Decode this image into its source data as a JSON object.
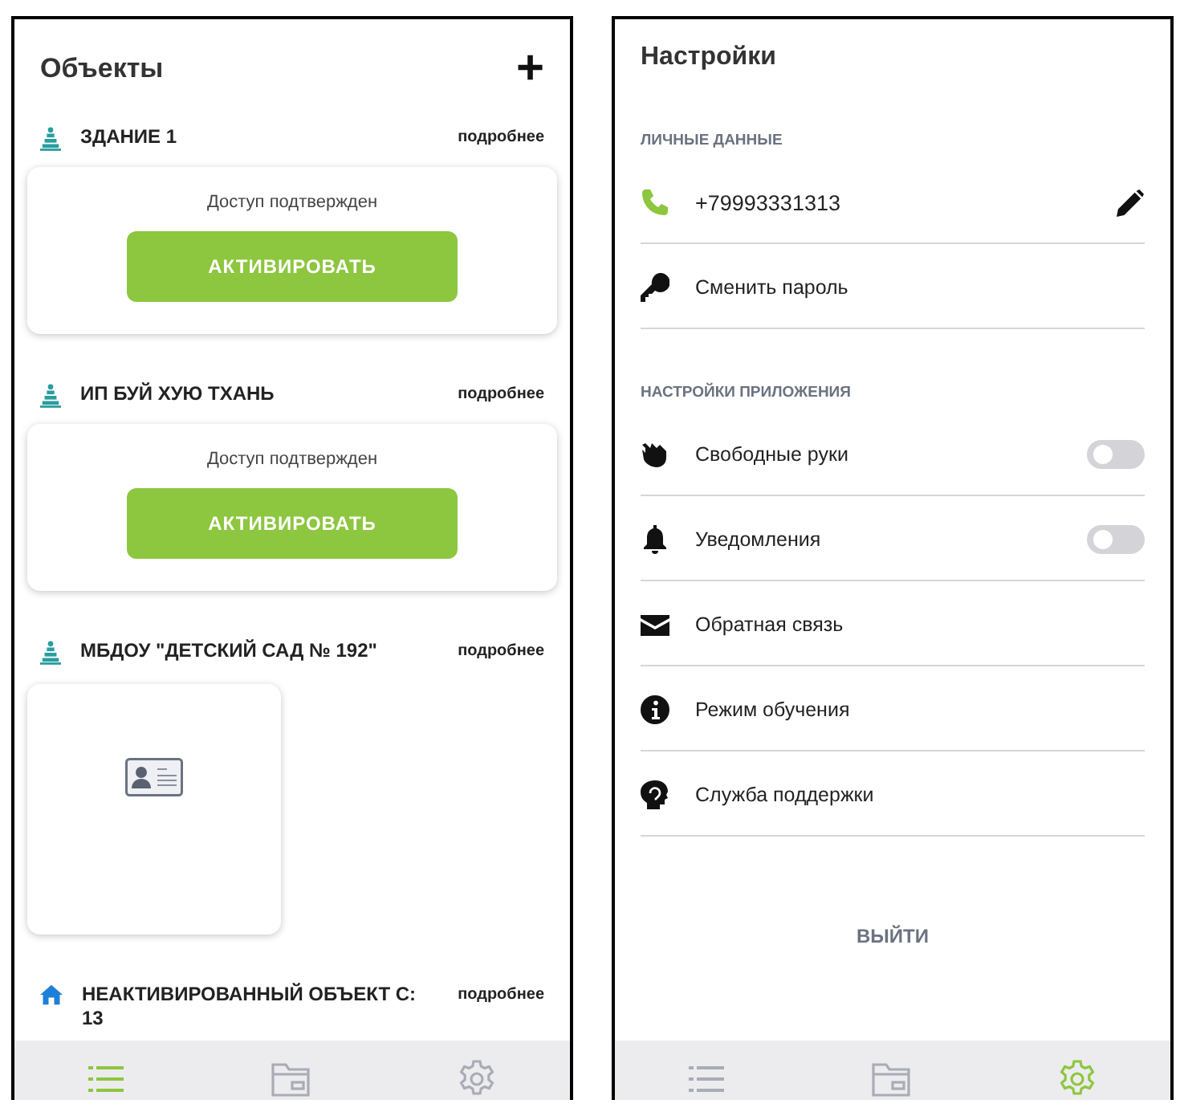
{
  "objects_screen": {
    "title": "Объекты",
    "add_button": "+",
    "objects": [
      {
        "kind": "active",
        "name": "ЗДАНИЕ 1",
        "link": "подробнее",
        "card": {
          "kind": "access",
          "status": "Доступ подтвержден",
          "button": "АКТИВИРОВАТЬ"
        }
      },
      {
        "kind": "active",
        "name": "ИП БУЙ ХУЮ ТХАНЬ",
        "link": "подробнее",
        "card": {
          "kind": "access",
          "status": "Доступ подтвержден",
          "button": "АКТИВИРОВАТЬ"
        }
      },
      {
        "kind": "active",
        "name": "МБДОУ \"ДЕТСКИЙ САД № 192\"",
        "link": "подробнее",
        "card": {
          "kind": "id_card"
        }
      },
      {
        "kind": "inactive",
        "name": "НЕАКТИВИРОВАННЫЙ ОБЪЕКТ С: 13",
        "link": "подробнее"
      }
    ],
    "nav": [
      {
        "selected": true
      },
      {
        "selected": false
      },
      {
        "selected": false
      }
    ]
  },
  "settings_screen": {
    "title": "Настройки",
    "sections": [
      {
        "title": "ЛИЧНЫЕ ДАННЫЕ",
        "items": [
          {
            "label": "+79993331313",
            "kind": "edit"
          },
          {
            "label": "Сменить пароль",
            "kind": "plain"
          }
        ]
      },
      {
        "title": "НАСТРОЙКИ ПРИЛОЖЕНИЯ",
        "items": [
          {
            "label": "Свободные руки",
            "kind": "toggle",
            "on": false
          },
          {
            "label": "Уведомления",
            "kind": "toggle",
            "on": false
          },
          {
            "label": "Обратная связь",
            "kind": "plain"
          },
          {
            "label": "Режим обучения",
            "kind": "plain"
          },
          {
            "label": "Служба поддержки",
            "kind": "plain"
          }
        ]
      }
    ],
    "logout": "ВЫЙТИ",
    "nav": [
      {
        "selected": false
      },
      {
        "selected": false
      },
      {
        "selected": true
      }
    ]
  }
}
